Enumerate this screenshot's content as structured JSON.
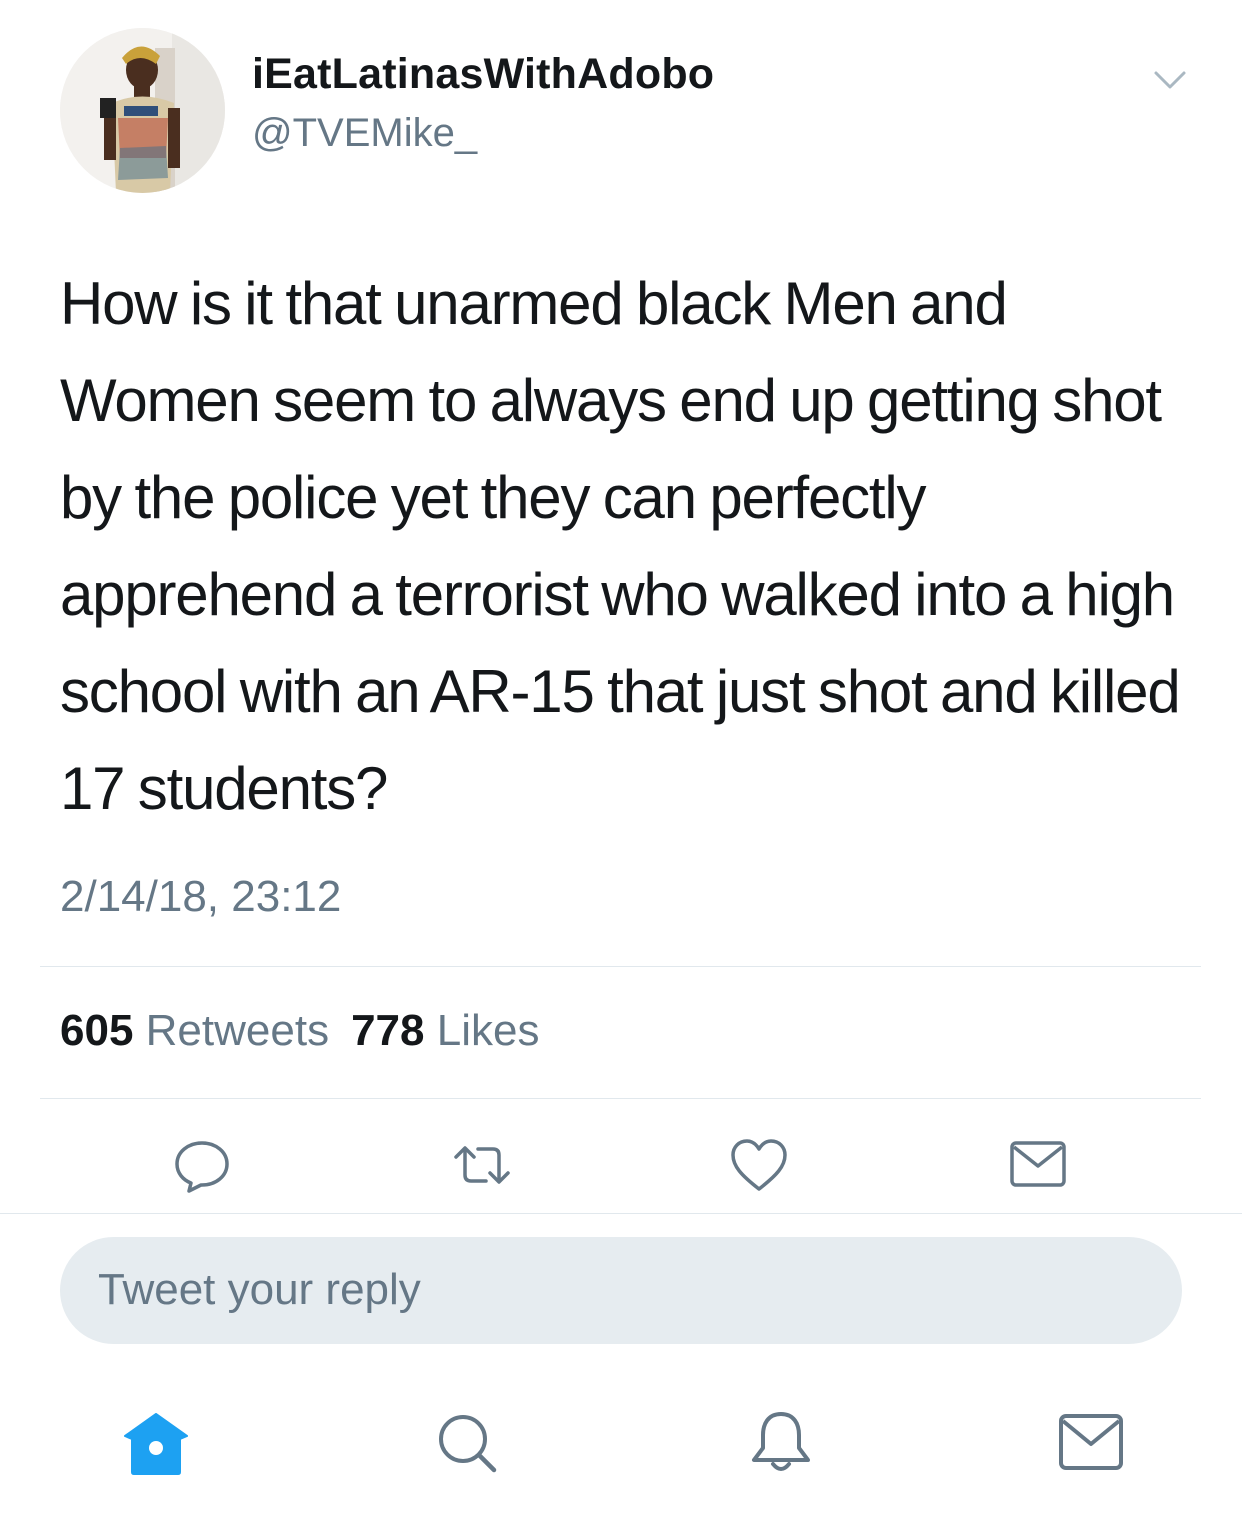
{
  "tweet": {
    "display_name": "iEatLatinasWithAdobo",
    "handle": "@TVEMike_",
    "text": "How is it that unarmed black Men and Women seem to always end up getting shot by the police yet they can perfectly apprehend a terrorist who walked into a high school with an AR-15 that just shot and killed 17 students?",
    "timestamp": "2/14/18, 23:12"
  },
  "stats": {
    "retweets_count": "605",
    "retweets_label": "Retweets",
    "likes_count": "778",
    "likes_label": "Likes"
  },
  "reply": {
    "placeholder": "Tweet your reply"
  },
  "icons": {
    "caret": "chevron-down-icon",
    "actions": [
      "reply-icon",
      "retweet-icon",
      "like-icon",
      "direct-message-icon"
    ],
    "tabbar": [
      "home-icon",
      "search-icon",
      "notifications-icon",
      "messages-icon"
    ]
  },
  "colors": {
    "text": "#14171a",
    "secondary": "#657786",
    "accent": "#1da1f2",
    "reply_bg": "#e6ecf0",
    "divider": "#e1e8ed"
  }
}
